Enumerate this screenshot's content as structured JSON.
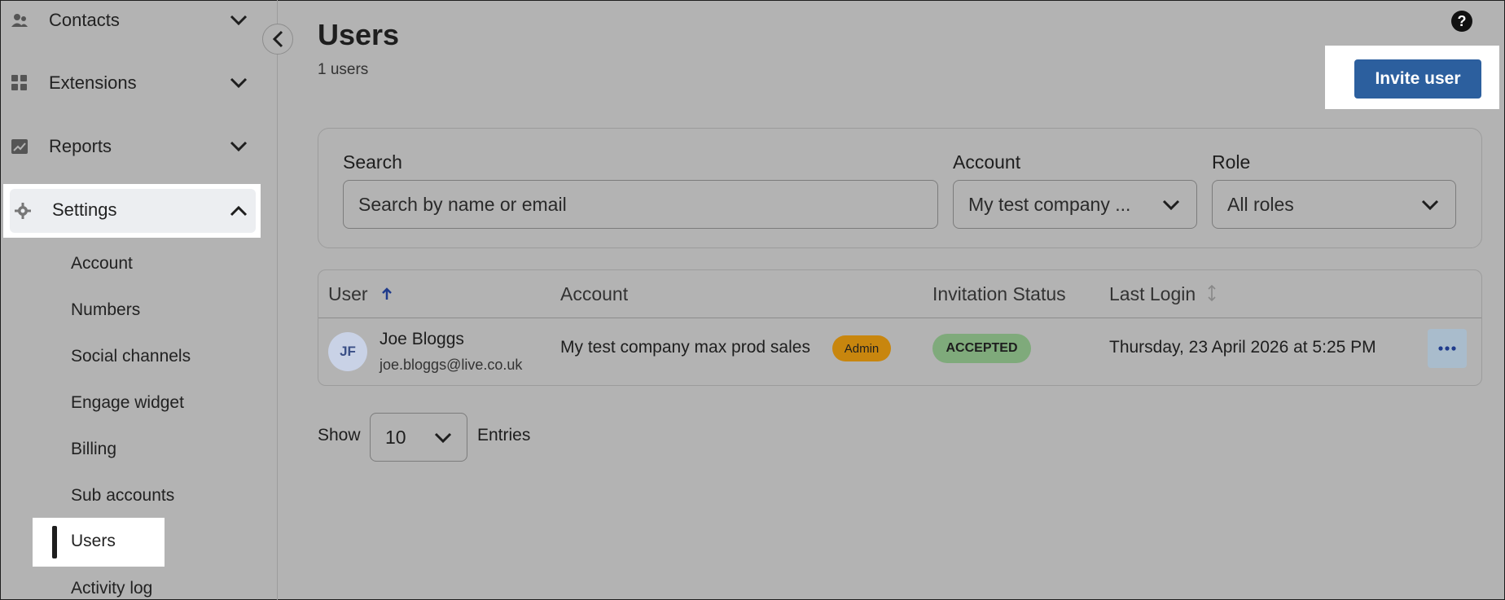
{
  "sidebar": {
    "groups": [
      {
        "label": "Contacts",
        "icon": "contacts-icon"
      },
      {
        "label": "Extensions",
        "icon": "extensions-grid-icon"
      },
      {
        "label": "Reports",
        "icon": "reports-chart-icon"
      },
      {
        "label": "Settings",
        "icon": "gear-icon"
      }
    ],
    "settings_items": [
      "Account",
      "Numbers",
      "Social channels",
      "Engage widget",
      "Billing",
      "Sub accounts",
      "Users",
      "Activity log"
    ],
    "active_item": "Users"
  },
  "header": {
    "title": "Users",
    "count": "1 users",
    "invite_label": "Invite user",
    "help": "?"
  },
  "filters": {
    "search_label": "Search",
    "search_placeholder": "Search by name or email",
    "account_label": "Account",
    "account_value": "My test company ...",
    "role_label": "Role",
    "role_value": "All roles"
  },
  "table": {
    "columns": [
      "User",
      "Account",
      "Invitation Status",
      "Last Login"
    ],
    "rows": [
      {
        "initials": "JF",
        "name": "Joe Bloggs",
        "email": "joe.bloggs@live.co.uk",
        "account": "My test company max prod sales",
        "role_badge": "Admin",
        "status": "ACCEPTED",
        "last_login": "Thursday, 23 April 2026 at 5:25 PM"
      }
    ]
  },
  "pagination": {
    "show_label": "Show",
    "page_size": "10",
    "entries_label": "Entries"
  },
  "colors": {
    "overlay": "#b3b3b3",
    "primary": "#2c5f9e",
    "admin_badge": "#c8860e",
    "accepted_badge": "#7faa7b"
  }
}
